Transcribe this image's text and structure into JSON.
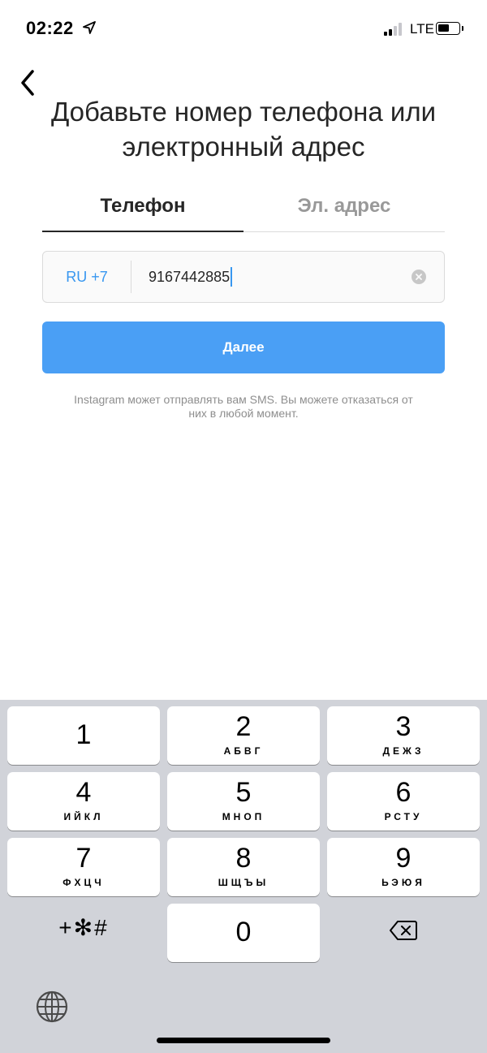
{
  "status_bar": {
    "time": "02:22",
    "network": "LTE",
    "icons": [
      "location-arrow-icon",
      "signal-icon",
      "battery-icon"
    ]
  },
  "header": {
    "back_icon": "chevron-left-icon",
    "title": "Добавьте номер телефона или электронный адрес"
  },
  "tabs": [
    {
      "label": "Телефон",
      "active": true
    },
    {
      "label": "Эл. адрес",
      "active": false
    }
  ],
  "phone_form": {
    "country_code": "RU +7",
    "phone_value": "9167442885",
    "clear_icon": "clear-circle-icon"
  },
  "next_button": {
    "label": "Далее"
  },
  "sms_note": "Instagram может отправлять вам SMS. Вы можете отказаться от них в любой момент.",
  "keypad": {
    "keys": [
      {
        "digit": "1",
        "letters": ""
      },
      {
        "digit": "2",
        "letters": "АБВГ"
      },
      {
        "digit": "3",
        "letters": "ДЕЖЗ"
      },
      {
        "digit": "4",
        "letters": "ИЙКЛ"
      },
      {
        "digit": "5",
        "letters": "МНОП"
      },
      {
        "digit": "6",
        "letters": "РСТУ"
      },
      {
        "digit": "7",
        "letters": "ФХЦЧ"
      },
      {
        "digit": "8",
        "letters": "ШЩЪЫ"
      },
      {
        "digit": "9",
        "letters": "ЬЭЮЯ"
      },
      {
        "digit": "0",
        "letters": ""
      }
    ],
    "symbols_key": "+✻#",
    "delete_icon": "backspace-icon",
    "globe_icon": "globe-icon"
  },
  "colors": {
    "accent": "#3897f0",
    "button": "#4a9ff5",
    "keyboard_bg": "#d1d3d9",
    "muted_text": "#8e8e8e"
  }
}
